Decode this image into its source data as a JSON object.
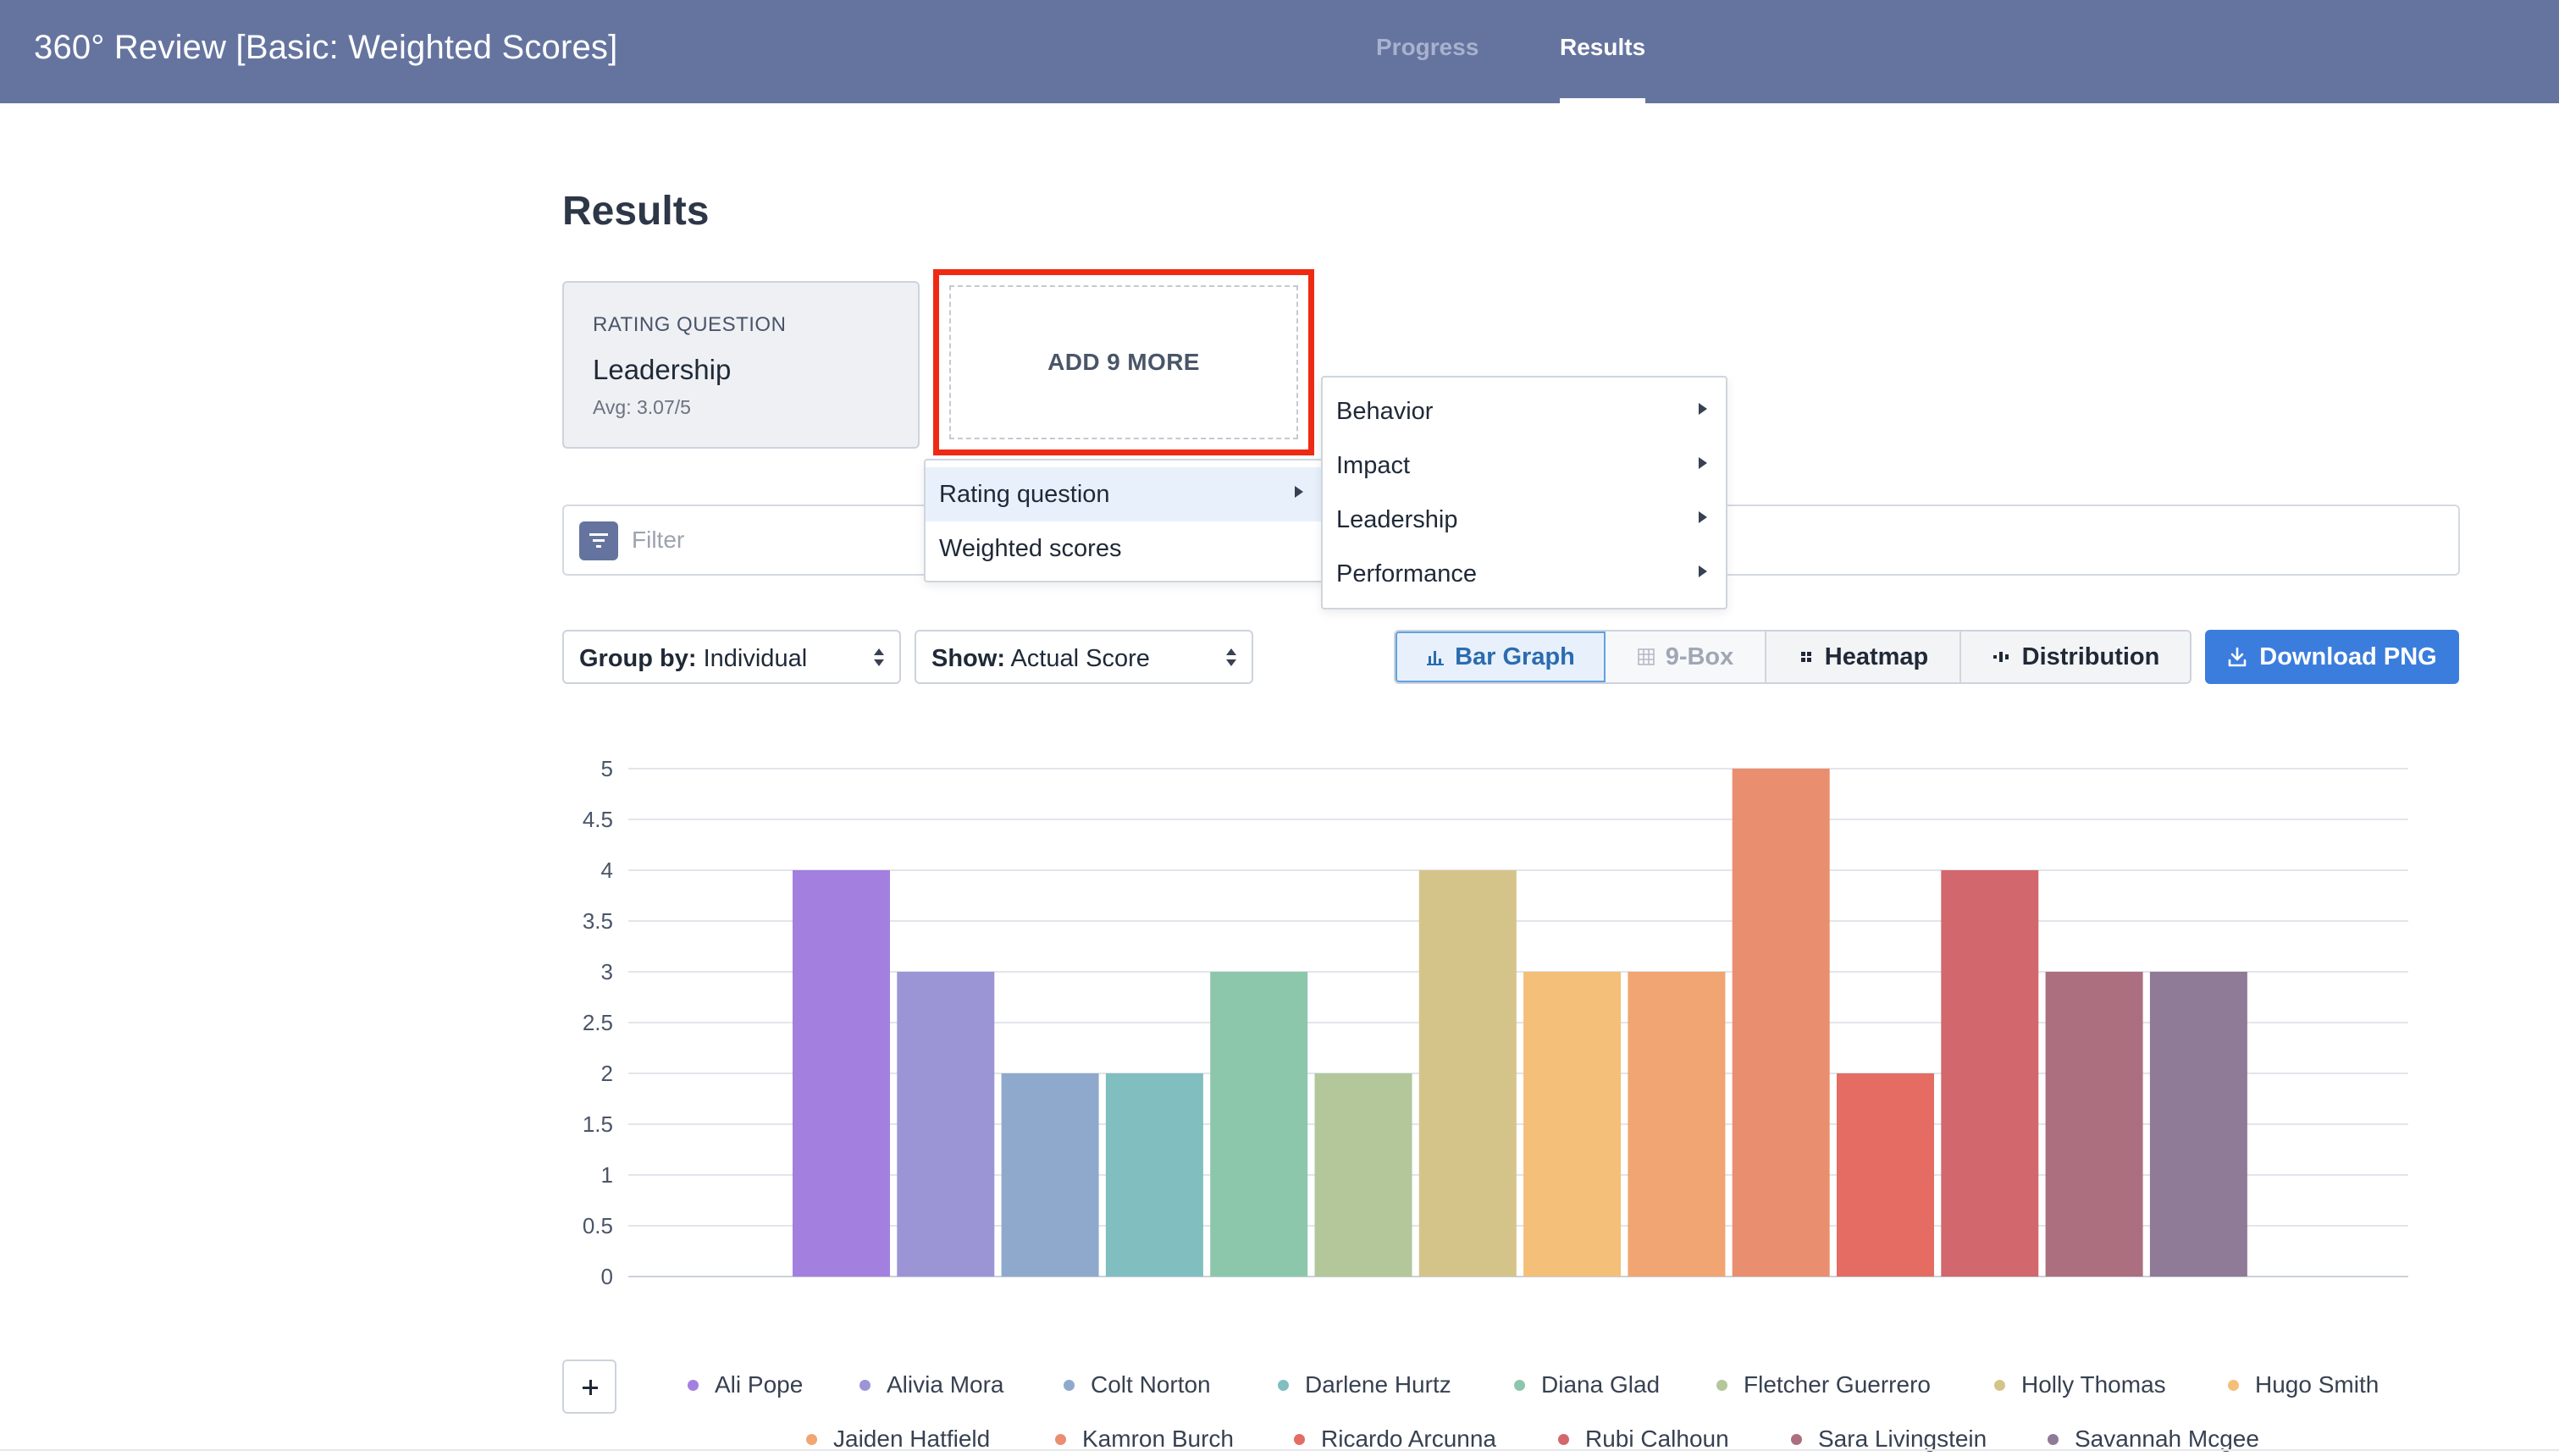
{
  "header": {
    "app_title": "360° Review [Basic: Weighted Scores]",
    "tabs": [
      {
        "label": "Progress",
        "active": false
      },
      {
        "label": "Results",
        "active": true
      }
    ]
  },
  "page": {
    "title": "Results"
  },
  "question_card": {
    "type_label": "RATING QUESTION",
    "name": "Leadership",
    "avg": "Avg: 3.07/5"
  },
  "add_more": {
    "label": "ADD 9 MORE"
  },
  "filter": {
    "placeholder": "Filter"
  },
  "menu_main": {
    "items": [
      {
        "label": "Rating question",
        "has_submenu": true,
        "active": true
      },
      {
        "label": "Weighted scores",
        "has_submenu": false,
        "active": false
      }
    ]
  },
  "menu_sub": {
    "items": [
      {
        "label": "Behavior"
      },
      {
        "label": "Impact"
      },
      {
        "label": "Leadership"
      },
      {
        "label": "Performance"
      }
    ]
  },
  "controls": {
    "group_by": {
      "prefix": "Group by:",
      "value": "Individual"
    },
    "show": {
      "prefix": "Show:",
      "value": "Actual Score"
    },
    "views": [
      {
        "label": "Bar Graph",
        "icon": "bar-chart-icon",
        "state": "active"
      },
      {
        "label": "9-Box",
        "icon": "grid-icon",
        "state": "disabled"
      },
      {
        "label": "Heatmap",
        "icon": "heatmap-icon",
        "state": "normal"
      },
      {
        "label": "Distribution",
        "icon": "distribution-icon",
        "state": "normal"
      }
    ],
    "download_label": "Download PNG"
  },
  "chart_data": {
    "type": "bar",
    "categories": [
      "Ali Pope",
      "Alivia Mora",
      "Colt Norton",
      "Darlene Hurtz",
      "Diana Glad",
      "Fletcher Guerrero",
      "Holly Thomas",
      "Hugo Smith",
      "Jaiden Hatfield",
      "Kamron Burch",
      "Ricardo Arcunna",
      "Rubi Calhoun",
      "Sara Livingstein",
      "Savannah Mcgee"
    ],
    "values": [
      4,
      3,
      2,
      2,
      3,
      2,
      4,
      3,
      3,
      5,
      2,
      4,
      3,
      3
    ],
    "colors": [
      "#a37fe0",
      "#9b95d6",
      "#8ea9cb",
      "#80bebf",
      "#8dc7ab",
      "#b3c79b",
      "#d5c48a",
      "#f4bf78",
      "#f0a572",
      "#e98e6e",
      "#e46c62",
      "#d2676d",
      "#ab6f7f",
      "#8f7a97"
    ],
    "ylim": [
      0,
      5
    ],
    "yticks": [
      0,
      0.5,
      1,
      1.5,
      2,
      2.5,
      3,
      3.5,
      4,
      4.5,
      5
    ],
    "grid": true,
    "legend_placement": "bottom"
  }
}
